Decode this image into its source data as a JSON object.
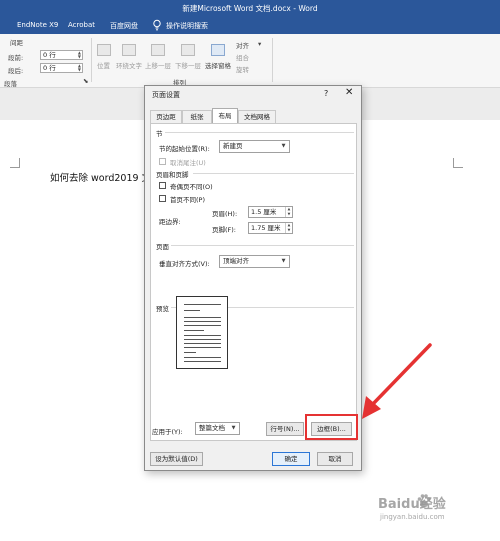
{
  "titlebar": {
    "title": "新建Microsoft Word 文档.docx - Word"
  },
  "menu": {
    "items": [
      "EndNote X9",
      "Acrobat",
      "百度网盘",
      "操作说明搜索"
    ]
  },
  "ribbon": {
    "spacing_group": "间距",
    "before_label": "段前:",
    "before_value": "0 行",
    "after_label": "段后:",
    "after_value": "0 行",
    "paragraph_label": "段落",
    "position_label": "位置",
    "wrap_label": "环绕文字",
    "bring_forward_label": "上移一层",
    "send_backward_label": "下移一层",
    "selection_pane_label": "选择窗格",
    "align_label": "对齐",
    "group_label": "组合",
    "rotate_label": "旋转",
    "arrange_label": "排列"
  },
  "document": {
    "text": "如何去除 word2019 文"
  },
  "dialog": {
    "title": "页面设置",
    "help": "?",
    "close": "✕",
    "tabs": [
      "页边距",
      "纸张",
      "布局",
      "文档网格"
    ],
    "section_label": "节",
    "section_start_label": "节的起始位置(R):",
    "section_start_value": "新建页",
    "suppress_endnotes_label": "取消尾注(U)",
    "header_footer_label": "页眉和页脚",
    "odd_even_label": "奇偶页不同(O)",
    "first_page_label": "首页不同(P)",
    "from_edge_label": "距边界:",
    "header_label": "页眉(H):",
    "header_value": "1.5 厘米",
    "footer_label": "页脚(F):",
    "footer_value": "1.75 厘米",
    "page_label": "页面",
    "vertical_align_label": "垂直对齐方式(V):",
    "vertical_align_value": "顶端对齐",
    "preview_label": "预览",
    "apply_to_label": "应用于(Y):",
    "apply_to_value": "整篇文档",
    "line_numbers_button": "行号(N)...",
    "borders_button": "边框(B)...",
    "set_default_button": "设为默认值(D)",
    "ok_button": "确定",
    "cancel_button": "取消"
  },
  "watermark": {
    "brand": "Baidu经验",
    "url": "jingyan.baidu.com"
  },
  "colors": {
    "title_bar": "#2b579a",
    "highlight": "#e53232"
  }
}
